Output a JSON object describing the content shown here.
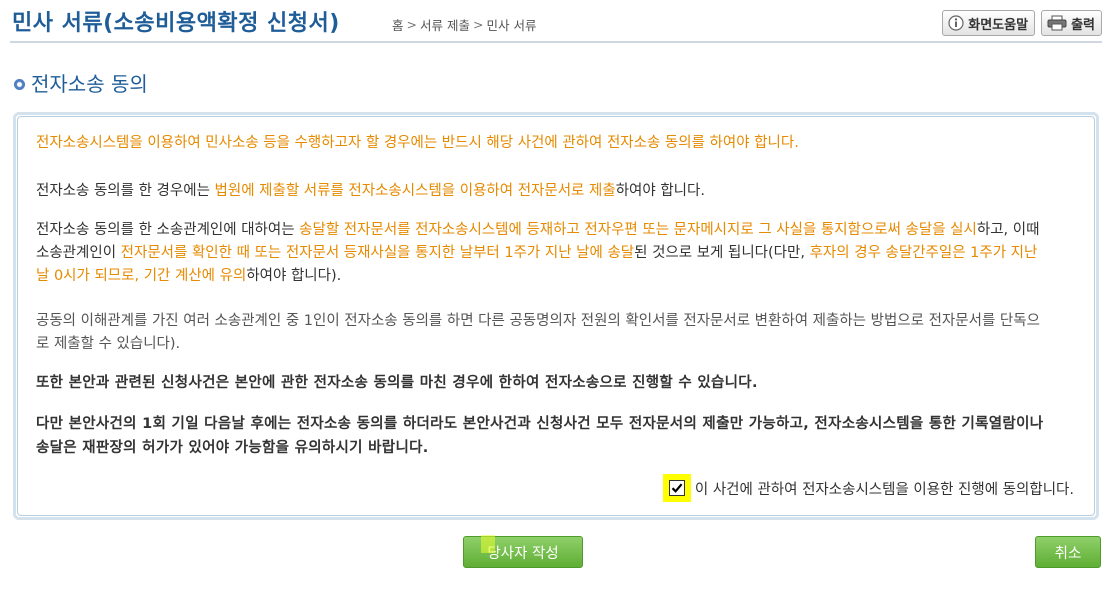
{
  "header": {
    "title": "민사 서류(소송비용액확정 신청서)",
    "breadcrumb": [
      "홈",
      "서류 제출",
      "민사 서류"
    ],
    "help_label": "화면도움말",
    "print_label": "출력"
  },
  "section": {
    "title": "전자소송 동의"
  },
  "content": {
    "intro": "전자소송시스템을 이용하여 민사소송 등을 수행하고자 할 경우에는 반드시 해당 사건에 관하여 전자소송 동의를 하여야 합니다.",
    "p1": {
      "a": "전자소송 동의를 한 경우에는 ",
      "b": "법원에 제출할 서류를 전자소송시스템을 이용하여 전자문서로 제출",
      "c": "하여야 합니다."
    },
    "p2": {
      "a": "전자소송 동의를 한 소송관계인에 대하여는 ",
      "b": "송달할 전자문서를 전자소송시스템에 등재하고 전자우편 또는 문자메시지로 그 사실을 통지함으로써 송달을 실시",
      "c": "하고, 이때 소송관계인이 ",
      "d": "전자문서를 확인한 때 또는 전자문서 등재사실을 통지한 날부터 1주가 지난 날에 송달",
      "e": "된 것으로 보게 됩니다(다만, ",
      "f": "후자의 경우 송달간주일은 1주가 지난 날 0시가 되므로, 기간 계산에 유의",
      "g": "하여야 합니다)."
    },
    "p3": "공동의 이해관계를 가진 여러 소송관계인 중 1인이 전자소송 동의를 하면 다른 공동명의자 전원의 확인서를 전자문서로 변환하여 제출하는 방법으로 전자문서를 단독으로 제출할 수 있습니다).",
    "p4": "또한 본안과 관련된 신청사건은 본안에 관한 전자소송 동의를 마친 경우에 한하여 전자소송으로 진행할 수 있습니다.",
    "p5": "다만 본안사건의 1회 기일 다음날 후에는 전자소송 동의를 하더라도 본안사건과 신청사건 모두 전자문서의 제출만 가능하고, 전자소송시스템을 통한 기록열람이나 송달은 재판장의 허가가 있어야 가능함을 유의하시기 바랍니다.",
    "agree_label": "이 사건에 관하여 전자소송시스템을 이용한 진행에 동의합니다.",
    "agree_checked": true
  },
  "buttons": {
    "party_label": "당사자 작성",
    "cancel_label": "취소"
  },
  "colors": {
    "title_blue": "#1f5d99",
    "highlight_orange": "#e68a00",
    "button_green": "#6bb83f",
    "checkbox_highlight": "#ffff00"
  },
  "icons": {
    "help": "info-icon",
    "print": "printer-icon",
    "section": "bullet-icon",
    "check": "checkmark-icon"
  }
}
